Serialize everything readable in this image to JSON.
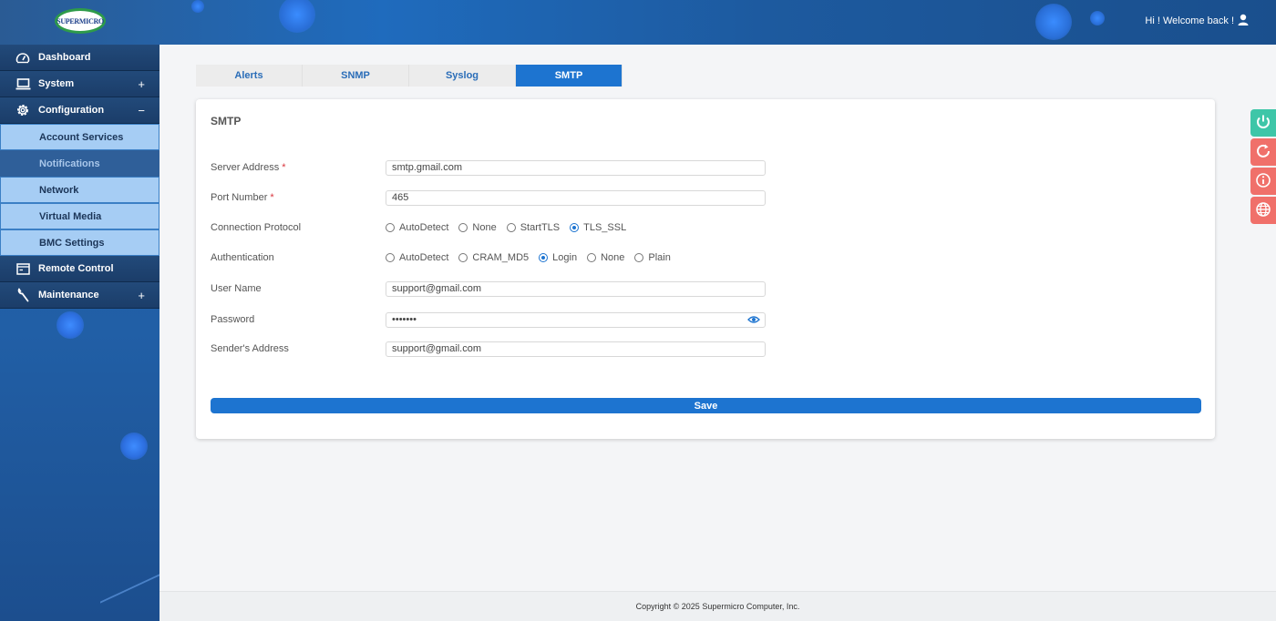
{
  "header": {
    "logo_text": "SUPERMICRO",
    "welcome": "Hi ! Welcome back !"
  },
  "sidebar": {
    "items": [
      {
        "label": "Dashboard",
        "icon": "dashboard-gauge-icon",
        "toggle": ""
      },
      {
        "label": "System",
        "icon": "laptop-icon",
        "toggle": "+"
      },
      {
        "label": "Configuration",
        "icon": "gear-icon",
        "toggle": "−"
      },
      {
        "label": "Remote Control",
        "icon": "console-window-icon",
        "toggle": ""
      },
      {
        "label": "Maintenance",
        "icon": "wrench-icon",
        "toggle": "+"
      }
    ],
    "sub_items": [
      {
        "label": "Account Services",
        "active": false
      },
      {
        "label": "Notifications",
        "active": true
      },
      {
        "label": "Network",
        "active": false
      },
      {
        "label": "Virtual Media",
        "active": false
      },
      {
        "label": "BMC Settings",
        "active": false
      }
    ]
  },
  "tabs": [
    {
      "label": "Alerts",
      "active": false
    },
    {
      "label": "SNMP",
      "active": false
    },
    {
      "label": "Syslog",
      "active": false
    },
    {
      "label": "SMTP",
      "active": true
    }
  ],
  "form": {
    "title": "SMTP",
    "server_address": {
      "label": "Server Address",
      "required": "*",
      "value": "smtp.gmail.com"
    },
    "port_number": {
      "label": "Port Number",
      "required": "*",
      "value": "465"
    },
    "connection_protocol": {
      "label": "Connection Protocol",
      "options": [
        "AutoDetect",
        "None",
        "StartTLS",
        "TLS_SSL"
      ],
      "selected": "TLS_SSL"
    },
    "authentication": {
      "label": "Authentication",
      "options": [
        "AutoDetect",
        "CRAM_MD5",
        "Login",
        "None",
        "Plain"
      ],
      "selected": "Login"
    },
    "user_name": {
      "label": "User Name",
      "value": "support@gmail.com"
    },
    "password": {
      "label": "Password",
      "value": "•••••••"
    },
    "senders_address": {
      "label": "Sender's Address",
      "value": "support@gmail.com"
    },
    "save_label": "Save"
  },
  "footer": {
    "copyright": "Copyright © 2025 Supermicro Computer, Inc."
  },
  "quick_actions": [
    {
      "icon": "power-icon",
      "color": "#3ec6a8"
    },
    {
      "icon": "refresh-icon",
      "color": "#f0706a"
    },
    {
      "icon": "info-icon",
      "color": "#f0706a"
    },
    {
      "icon": "globe-icon",
      "color": "#f0706a"
    }
  ],
  "colors": {
    "accent": "#1d74d0",
    "required": "#d9363e"
  }
}
